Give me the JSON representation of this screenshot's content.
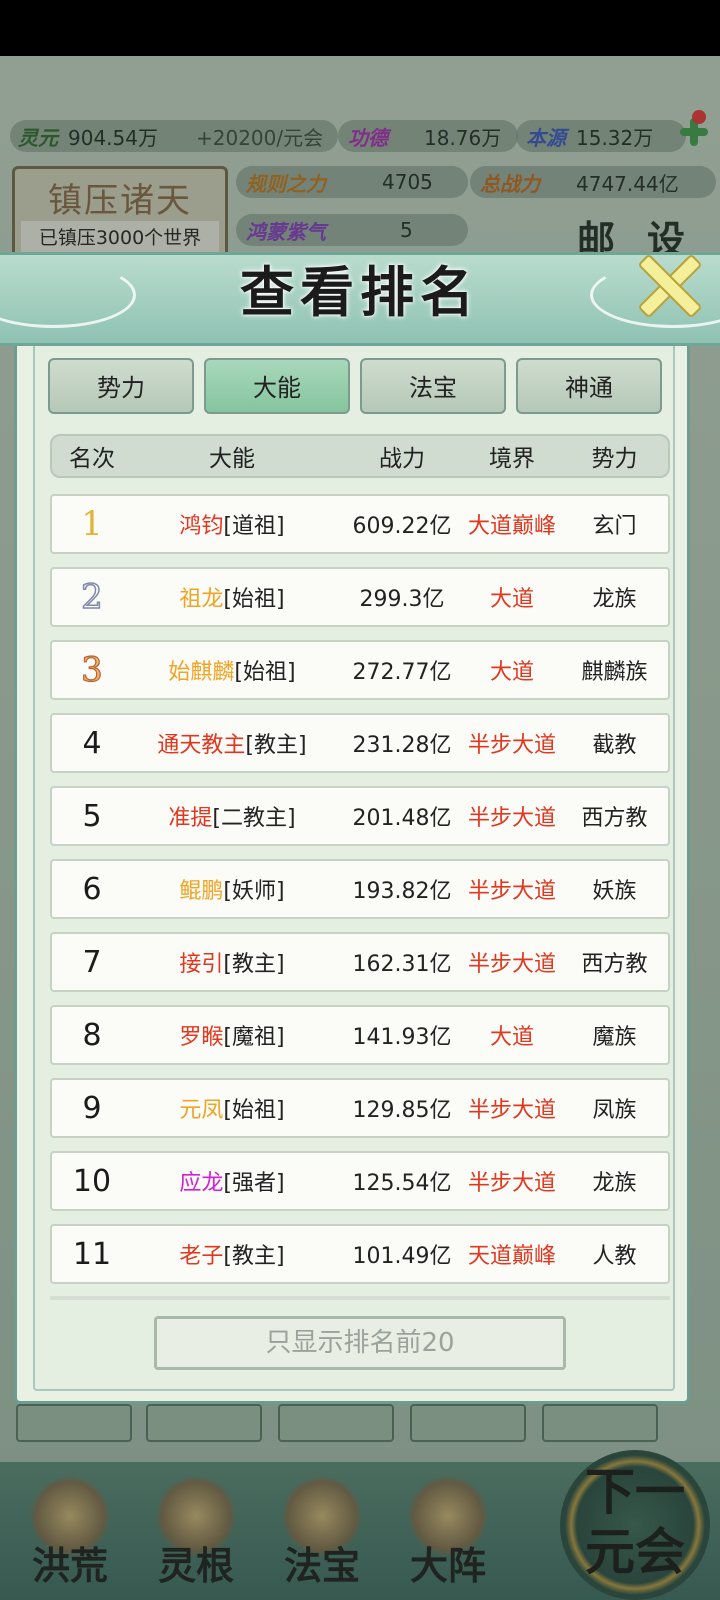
{
  "resources": {
    "lingyuan_label": "灵元",
    "lingyuan_value": "904.54万",
    "lingyuan_rate": "+20200/元会",
    "gongde_label": "功德",
    "gongde_value": "18.76万",
    "benyuan_label": "本源",
    "benyuan_value": "15.32万",
    "guize_label": "规则之力",
    "guize_value": "4705",
    "zongzhanli_label": "总战力",
    "zongzhanli_value": "4747.44亿",
    "hongmeng_label": "鸿蒙紫气",
    "hongmeng_value": "5"
  },
  "suppress": {
    "title": "镇压诸天",
    "subtitle": "已镇压3000个世界"
  },
  "top_buttons": {
    "mail": "邮",
    "settings": "设"
  },
  "modal": {
    "title": "查看排名",
    "tabs": [
      {
        "label": "势力",
        "active": false
      },
      {
        "label": "大能",
        "active": true
      },
      {
        "label": "法宝",
        "active": false
      },
      {
        "label": "神通",
        "active": false
      }
    ],
    "columns": [
      "名次",
      "大能",
      "战力",
      "境界",
      "势力"
    ],
    "rows": [
      {
        "rank": "1",
        "name": "鸿钧",
        "title": "[道祖]",
        "name_color": "#e2371f",
        "power": "609.22亿",
        "realm": "大道巅峰",
        "faction": "玄门"
      },
      {
        "rank": "2",
        "name": "祖龙",
        "title": "[始祖]",
        "name_color": "#f0a424",
        "power": "299.3亿",
        "realm": "大道",
        "faction": "龙族"
      },
      {
        "rank": "3",
        "name": "始麒麟",
        "title": "[始祖]",
        "name_color": "#f0a424",
        "power": "272.77亿",
        "realm": "大道",
        "faction": "麒麟族"
      },
      {
        "rank": "4",
        "name": "通天教主",
        "title": "[教主]",
        "name_color": "#e2371f",
        "power": "231.28亿",
        "realm": "半步大道",
        "faction": "截教"
      },
      {
        "rank": "5",
        "name": "准提",
        "title": "[二教主]",
        "name_color": "#e2371f",
        "power": "201.48亿",
        "realm": "半步大道",
        "faction": "西方教"
      },
      {
        "rank": "6",
        "name": "鲲鹏",
        "title": "[妖师]",
        "name_color": "#f0a424",
        "power": "193.82亿",
        "realm": "半步大道",
        "faction": "妖族"
      },
      {
        "rank": "7",
        "name": "接引",
        "title": "[教主]",
        "name_color": "#e2371f",
        "power": "162.31亿",
        "realm": "半步大道",
        "faction": "西方教"
      },
      {
        "rank": "8",
        "name": "罗睺",
        "title": "[魔祖]",
        "name_color": "#e2371f",
        "power": "141.93亿",
        "realm": "大道",
        "faction": "魔族"
      },
      {
        "rank": "9",
        "name": "元凤",
        "title": "[始祖]",
        "name_color": "#f0a424",
        "power": "129.85亿",
        "realm": "半步大道",
        "faction": "凤族"
      },
      {
        "rank": "10",
        "name": "应龙",
        "title": "[强者]",
        "name_color": "#d21fd8",
        "power": "125.54亿",
        "realm": "半步大道",
        "faction": "龙族"
      },
      {
        "rank": "11",
        "name": "老子",
        "title": "[教主]",
        "name_color": "#e2371f",
        "power": "101.49亿",
        "realm": "天道巅峰",
        "faction": "人教"
      }
    ],
    "filter_button": "只显示排名前20"
  },
  "bottom_nav": [
    "洪荒",
    "灵根",
    "法宝",
    "大阵"
  ],
  "next_era": {
    "line1": "下一",
    "line2": "元会"
  },
  "colors": {
    "modal_bg": "#e9f1e5",
    "accent": "#6e9c91",
    "realm_red": "#e2371f"
  }
}
